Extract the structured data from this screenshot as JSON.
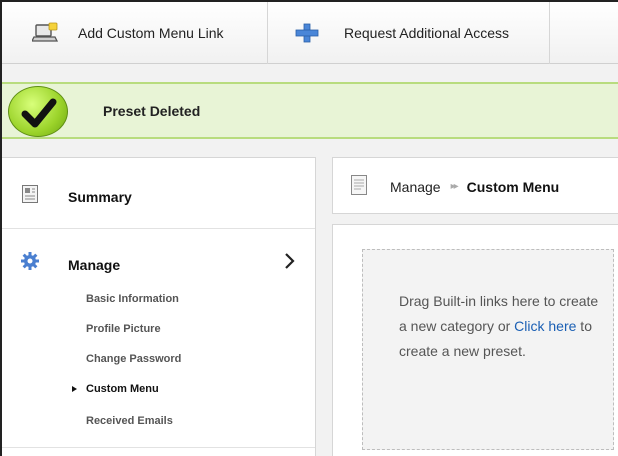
{
  "toolbar": {
    "add_custom_menu_link": {
      "label": "Add Custom Menu Link",
      "icon": "laptop-add-icon"
    },
    "request_access": {
      "label": "Request Additional Access",
      "icon": "plus-icon"
    }
  },
  "notice": {
    "text": "Preset Deleted",
    "icon": "checkmark-icon",
    "color": "#9bd32a"
  },
  "sidebar": {
    "summary": {
      "label": "Summary",
      "icon": "summary-icon"
    },
    "manage": {
      "label": "Manage",
      "icon": "gear-icon",
      "expanded_icon": "chevron-right-icon",
      "items": [
        {
          "label": "Basic Information",
          "active": false
        },
        {
          "label": "Profile Picture",
          "active": false
        },
        {
          "label": "Change Password",
          "active": false
        },
        {
          "label": "Custom Menu",
          "active": true
        },
        {
          "label": "Received Emails",
          "active": false
        }
      ]
    }
  },
  "breadcrumb": {
    "icon": "document-icon",
    "parent": "Manage",
    "separator": "▸▸",
    "current": "Custom Menu"
  },
  "dropzone": {
    "text_before": "Drag Built-in links here to create a new category or ",
    "link": "Click here",
    "text_after": " to create a new preset.",
    "link_color": "#1a5fb4"
  }
}
